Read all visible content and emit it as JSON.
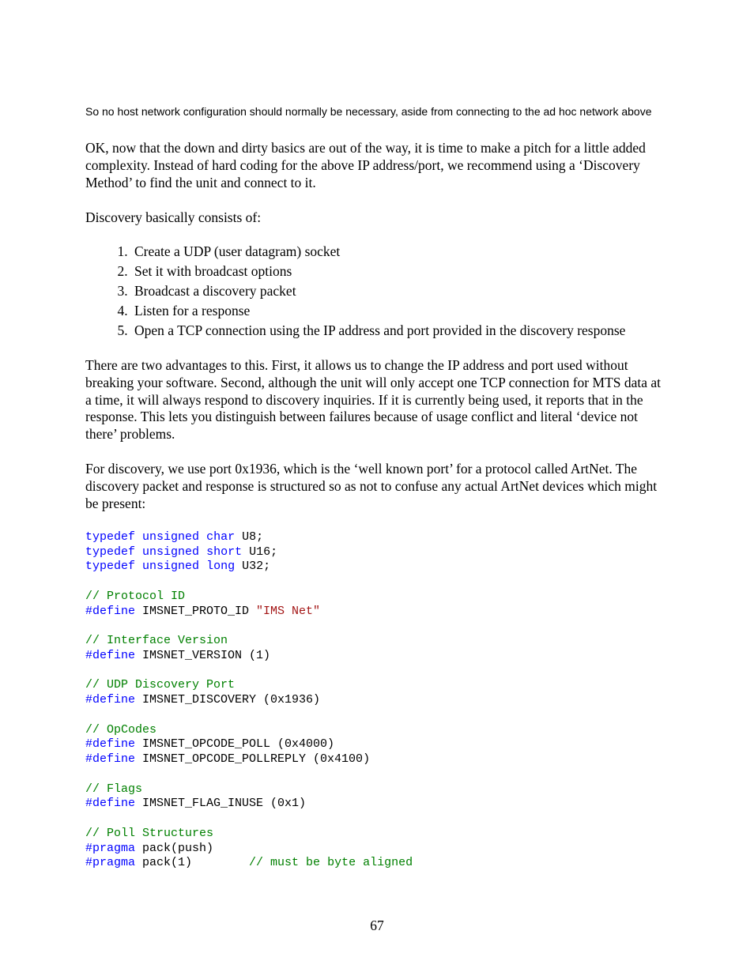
{
  "note": "So no host network configuration should normally be necessary, aside from connecting to the ad hoc network above",
  "para1": "OK, now that the down and dirty basics are out of the way, it is time to make a pitch for a little added complexity. Instead of hard coding for the above IP address/port, we recommend using a ‘Discovery Method’ to find the unit and connect to it.",
  "para2": "Discovery basically consists of:",
  "steps": [
    "Create a UDP (user datagram) socket",
    "Set it with broadcast options",
    "Broadcast a discovery packet",
    "Listen for a response",
    "Open a TCP connection using the IP address and port provided in the discovery response"
  ],
  "para3": "There are two advantages to this. First, it allows us to change the IP address and port used without breaking your software. Second, although the unit will only accept one TCP connection for MTS data at a time, it will always respond to discovery inquiries. If it is currently being used, it reports that in the response. This lets you distinguish between failures because of usage conflict and literal ‘device not there’ problems.",
  "para4": "For discovery, we use port 0x1936, which is the ‘well known port’ for a protocol called ArtNet. The discovery packet and response is structured so as not to confuse any actual ArtNet devices which might be present:",
  "code": {
    "l1a": "typedef",
    "l1b": " ",
    "l1c": "unsigned",
    "l1d": " ",
    "l1e": "char",
    "l1f": " U8;",
    "l2a": "typedef",
    "l2b": " ",
    "l2c": "unsigned",
    "l2d": " ",
    "l2e": "short",
    "l2f": " U16;",
    "l3a": "typedef",
    "l3b": " ",
    "l3c": "unsigned",
    "l3d": " ",
    "l3e": "long",
    "l3f": " U32;",
    "c1": "// Protocol ID",
    "l4a": "#define",
    "l4b": " IMSNET_PROTO_ID ",
    "l4c": "\"IMS Net\"",
    "c2": "// Interface Version",
    "l5a": "#define",
    "l5b": " IMSNET_VERSION (1)",
    "c3": "// UDP Discovery Port",
    "l6a": "#define",
    "l6b": " IMSNET_DISCOVERY (0x1936)",
    "c4": "// OpCodes",
    "l7a": "#define",
    "l7b": " IMSNET_OPCODE_POLL (0x4000)",
    "l8a": "#define",
    "l8b": " IMSNET_OPCODE_POLLREPLY (0x4100)",
    "c5": "// Flags",
    "l9a": "#define",
    "l9b": " IMSNET_FLAG_INUSE (0x1)",
    "c6": "// Poll Structures",
    "l10a": "#pragma",
    "l10b": " pack(push)",
    "l11a": "#pragma",
    "l11b": " pack(1)        ",
    "l11c": "// must be byte aligned"
  },
  "pagenum": "67"
}
